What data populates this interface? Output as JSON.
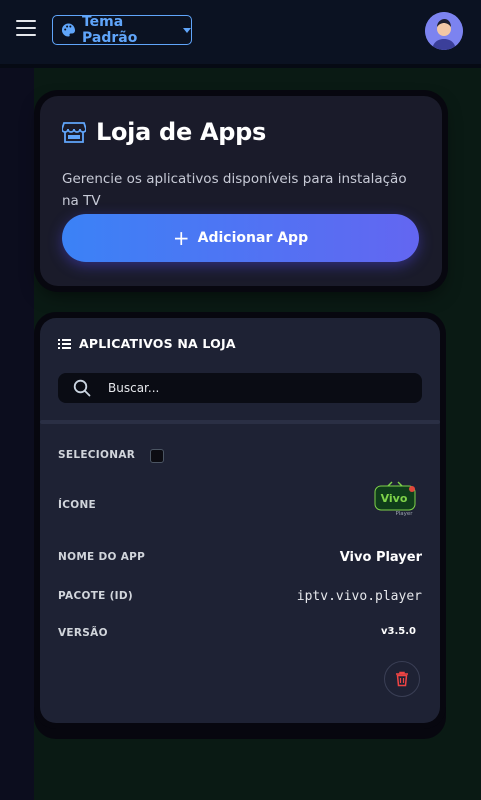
{
  "header": {
    "theme_label": "Tema Padrão"
  },
  "hero": {
    "title": "Loja de Apps",
    "subtitle": "Gerencie os aplicativos disponíveis para instalação na TV",
    "add_button_label": "Adicionar App"
  },
  "list": {
    "heading": "APLICATIVOS NA LOJA",
    "search_placeholder": "Buscar...",
    "labels": {
      "select": "SELECIONAR",
      "icon": "ÍCONE",
      "name": "NOME DO APP",
      "package": "PACOTE (ID)",
      "version": "VERSÃO"
    },
    "apps": [
      {
        "name": "Vivo Player",
        "package": "iptv.vivo.player",
        "version": "v3.5.0",
        "icon_text": "Vivo",
        "icon_sub": "Player",
        "selected": false
      }
    ]
  },
  "colors": {
    "accent": "#60a5fa",
    "button_gradient_start": "#3b82f6",
    "button_gradient_end": "#6366f1",
    "card": "#1e2234",
    "delete": "#ef4444"
  },
  "icons": [
    "menu-icon",
    "palette-icon",
    "chevron-down-icon",
    "avatar",
    "store-icon",
    "plus-icon",
    "list-icon",
    "search-icon",
    "trash-icon"
  ]
}
